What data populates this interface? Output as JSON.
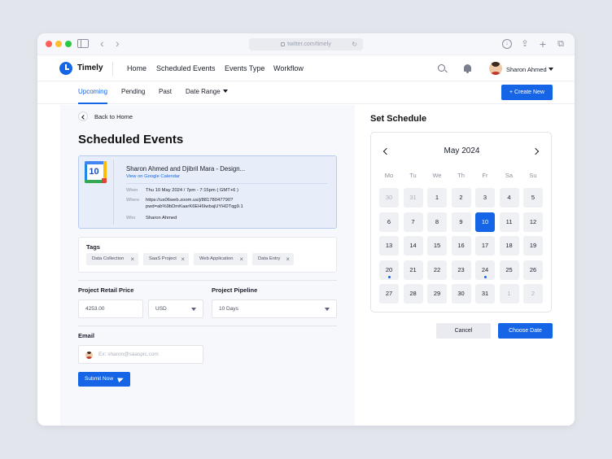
{
  "browser": {
    "url": "twitter.com/timely",
    "reload": "↻",
    "back": "‹",
    "forward": "›"
  },
  "app": {
    "brand": "Timely",
    "nav": [
      "Home",
      "Scheduled Events",
      "Events Type",
      "Workflow"
    ],
    "user": "Sharon Ahmed"
  },
  "subnav": {
    "tabs": [
      "Upcoming",
      "Pending",
      "Past",
      "Date Range"
    ],
    "create_label": "+ Create New"
  },
  "main": {
    "back_label": "Back to Home",
    "title": "Scheduled Events",
    "event": {
      "cal_day": "10",
      "title": "Sharon Ahmed and Djibril Mara - Design...",
      "link": "View on Google Calendar",
      "when_label": "When",
      "when_value": "Thu 10 May 2024 / 7pm - 7:15pm ( GMT+6 )",
      "where_label": "Where",
      "where_line1": "https://us06web.zoom.us/j/88178047790?",
      "where_line2": "pwd=ab%9bDmKaarK6EH6IwbajUYHDTqg9.1",
      "who_label": "Who",
      "who_value": "Sharon Ahmed"
    },
    "tags_label": "Tags",
    "tags": [
      "Data Collection",
      "SaaS Project",
      "Web Application",
      "Data Entry"
    ],
    "price_label": "Project Retail Price",
    "price_value": "4253.00",
    "currency": "USD",
    "pipeline_label": "Project  Pipeline",
    "pipeline_value": "10 Days",
    "email_label": "Email",
    "email_placeholder": "Ex: sharon@saaspic.com",
    "submit_label": "Submit Now"
  },
  "schedule": {
    "title": "Set Schedule",
    "month": "May 2024",
    "weekdays": [
      "Mo",
      "Tu",
      "We",
      "Th",
      "Fr",
      "Sa",
      "Su"
    ],
    "days": [
      "30",
      "31",
      "1",
      "2",
      "3",
      "4",
      "5",
      "6",
      "7",
      "8",
      "9",
      "10",
      "11",
      "12",
      "13",
      "14",
      "15",
      "16",
      "17",
      "18",
      "19",
      "20",
      "21",
      "22",
      "23",
      "24",
      "25",
      "26",
      "27",
      "28",
      "29",
      "30",
      "31",
      "1",
      "2"
    ],
    "muted_indices": [
      0,
      1,
      33,
      34
    ],
    "selected_index": 11,
    "event_dot_indices": [
      21,
      25
    ],
    "cancel_label": "Cancel",
    "choose_label": "Choose Date"
  },
  "colors": {
    "accent": "#1565e6"
  }
}
